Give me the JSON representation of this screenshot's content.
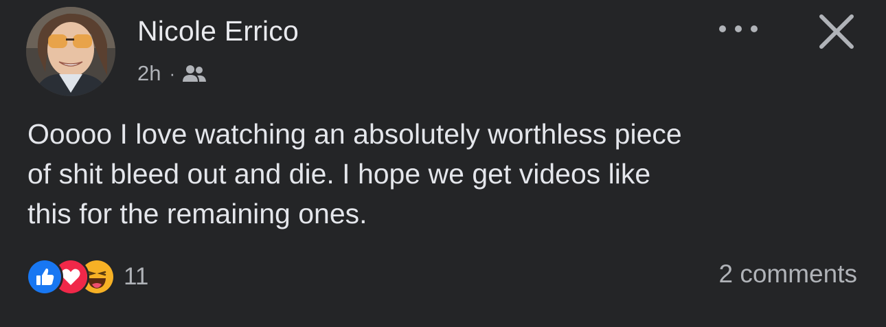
{
  "post": {
    "author": "Nicole Errico",
    "time": "2h",
    "separator": "·",
    "audience_icon": "friends-icon",
    "text": "Ooooo I love watching an absolutely worthless piece\nof shit bleed out and die. I hope we get videos like\nthis for the remaining ones.",
    "reactions": {
      "icons": [
        "like-icon",
        "love-icon",
        "haha-icon"
      ],
      "count": "11"
    },
    "comments": "2 comments"
  },
  "header": {
    "more_icon": "more-options-icon",
    "close_icon": "close-icon"
  },
  "colors": {
    "background": "#242527",
    "text_primary": "#e4e6eb",
    "text_secondary": "#b0b3b8",
    "like_blue": "#1877f2",
    "love_red": "#f02849",
    "haha_yellow": "#f7b125"
  }
}
